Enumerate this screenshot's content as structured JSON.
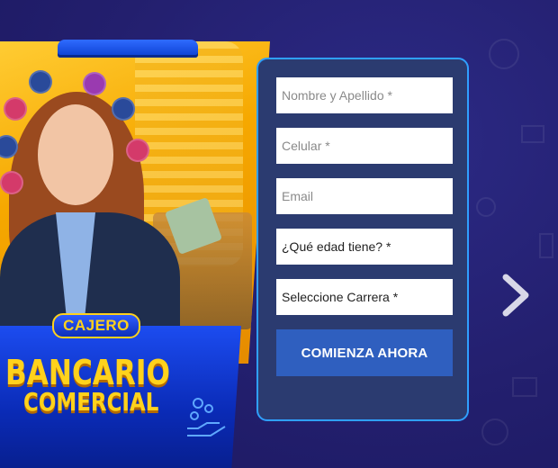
{
  "promo": {
    "badge": "CAJERO",
    "title_line1": "BANCARIO",
    "title_line2": "COMERCIAL"
  },
  "form": {
    "name_placeholder": "Nombre y Apellido *",
    "phone_placeholder": "Celular *",
    "email_placeholder": "Email",
    "age_select": "¿Qué edad tiene? *",
    "career_select": "Seleccione Carrera *",
    "submit_label": "COMIENZA AHORA"
  },
  "carousel": {
    "next_icon": "chevron-right-icon"
  },
  "colors": {
    "accent_blue": "#2f5fbf",
    "panel": "#2b3b70",
    "border": "#2fa0ff",
    "gold": "#ffd21c"
  }
}
